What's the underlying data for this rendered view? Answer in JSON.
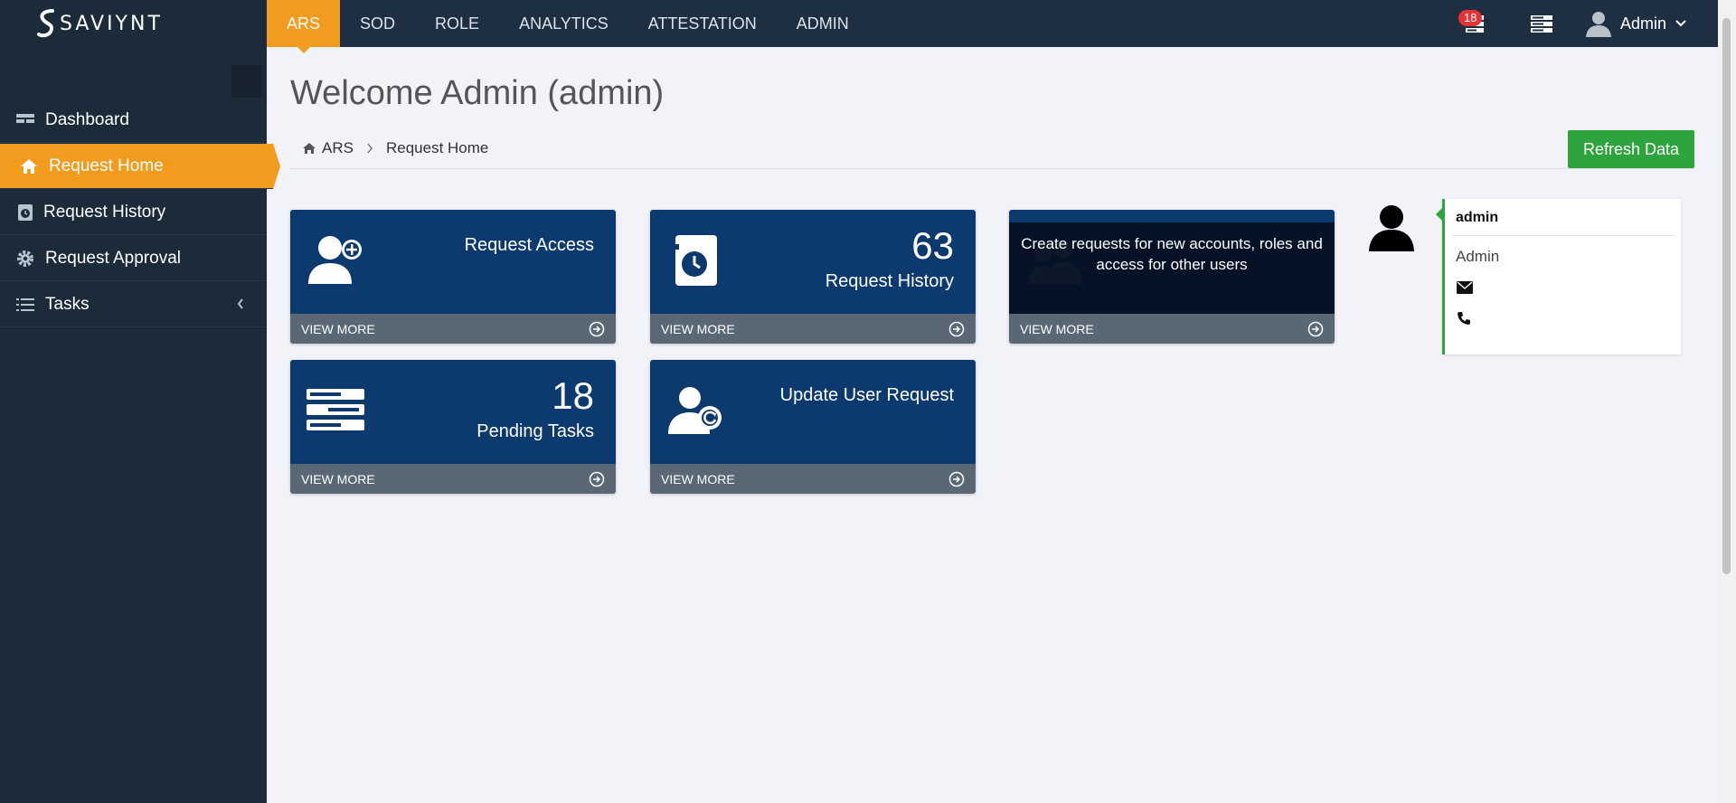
{
  "brand": {
    "name": "SAVIYNT"
  },
  "topnav": {
    "items": [
      {
        "label": "ARS",
        "active": true
      },
      {
        "label": "SOD"
      },
      {
        "label": "ROLE"
      },
      {
        "label": "ANALYTICS"
      },
      {
        "label": "ATTESTATION"
      },
      {
        "label": "ADMIN"
      }
    ],
    "notifications_count": "18",
    "user_label": "Admin"
  },
  "sidebar": {
    "items": [
      {
        "label": "Dashboard",
        "icon": "dashboard-icon"
      },
      {
        "label": "Request Home",
        "icon": "home-icon",
        "active": true
      },
      {
        "label": "Request History",
        "icon": "history-icon"
      },
      {
        "label": "Request Approval",
        "icon": "gear-icon"
      },
      {
        "label": "Tasks",
        "icon": "list-icon"
      }
    ]
  },
  "main": {
    "title": "Welcome Admin (admin)",
    "breadcrumb": [
      "ARS",
      "Request Home"
    ],
    "refresh_label": "Refresh Data",
    "tiles": [
      {
        "label": "Request Access",
        "footer": "VIEW MORE",
        "icon": "add-user-icon"
      },
      {
        "count": "63",
        "label": "Request History",
        "footer": "VIEW MORE",
        "icon": "calendar-clock-icon"
      },
      {
        "overlay": "Create requests for new accounts, roles and access for other users",
        "footer": "VIEW MORE",
        "icon": "group-add-icon"
      },
      {
        "count": "18",
        "label": "Pending Tasks",
        "footer": "VIEW MORE",
        "icon": "server-list-icon"
      },
      {
        "label": "Update User Request",
        "footer": "VIEW MORE",
        "icon": "user-refresh-icon"
      }
    ]
  },
  "profile": {
    "username": "admin",
    "role": "Admin"
  },
  "colors": {
    "topbar": "#1d2f40",
    "sidebar": "#1b2b3a",
    "accent": "#f19b1f",
    "tile": "#0d3a6e",
    "tile_footer": "#5a6876",
    "success": "#2ea43e",
    "badge": "#e53236"
  }
}
